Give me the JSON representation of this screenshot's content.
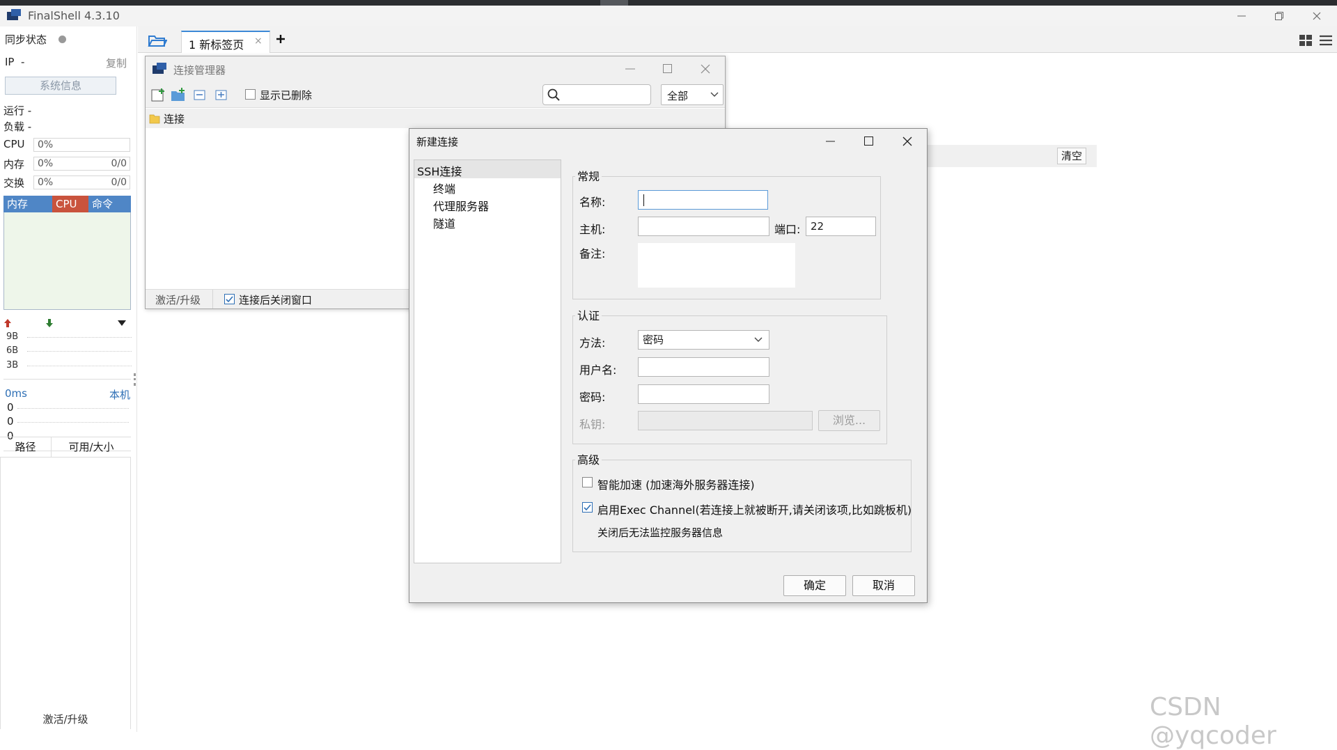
{
  "app": {
    "title": "FinalShell 4.3.10"
  },
  "sidebar": {
    "sync_label": "同步状态",
    "ip_label": "IP",
    "ip_value": "-",
    "copy_label": "复制",
    "sysinfo_button": "系统信息",
    "run_label": "运行 -",
    "load_label": "负载 -",
    "metrics": [
      {
        "label": "CPU",
        "value": "0%",
        "extra": ""
      },
      {
        "label": "内存",
        "value": "0%",
        "extra": "0/0"
      },
      {
        "label": "交换",
        "value": "0%",
        "extra": "0/0"
      }
    ],
    "proc_tabs": [
      "内存",
      "CPU",
      "命令"
    ],
    "net_scale": [
      "9B",
      "6B",
      "3B"
    ],
    "ping_label": "0ms",
    "ping_target": "本机",
    "ping_values": [
      "0",
      "0",
      "0"
    ],
    "disk_headers": [
      "路径",
      "可用/大小"
    ],
    "footer": "激活/升级"
  },
  "tabs": [
    {
      "label": "1 新标签页",
      "close": "×"
    }
  ],
  "console": {
    "clear_button": "清空"
  },
  "conn_manager": {
    "title": "连接管理器",
    "show_deleted_label": "显示已删除",
    "search_placeholder": "",
    "filter_value": "全部",
    "root_folder": "连接",
    "footer_activate": "激活/升级",
    "close_after_connect_label": "连接后关闭窗口"
  },
  "new_conn_dialog": {
    "title": "新建连接",
    "nav": [
      "SSH连接",
      "终端",
      "代理服务器",
      "隧道"
    ],
    "general": {
      "title": "常规",
      "name_label": "名称:",
      "name_value": "",
      "host_label": "主机:",
      "host_value": "",
      "port_label": "端口:",
      "port_value": "22",
      "note_label": "备注:"
    },
    "auth": {
      "title": "认证",
      "method_label": "方法:",
      "method_value": "密码",
      "user_label": "用户名:",
      "password_label": "密码:",
      "key_label": "私钥:",
      "browse_button": "浏览..."
    },
    "advanced": {
      "title": "高级",
      "smart_accel_label": "智能加速 (加速海外服务器连接)",
      "exec_channel_label": "启用Exec Channel(若连接上就被断开,请关闭该项,比如跳板机)",
      "exec_channel_note": "关闭后无法监控服务器信息"
    },
    "ok_button": "确定",
    "cancel_button": "取消"
  },
  "watermark": "CSDN @yqcoder",
  "colors": {
    "accent": "#3c88d6",
    "cpu_tab": "#c9533d",
    "mem_tab": "#4f86c6",
    "cmd_tab": "#4f86c6",
    "upload_arrow": "#c0392b",
    "download_arrow": "#2e7d32"
  }
}
